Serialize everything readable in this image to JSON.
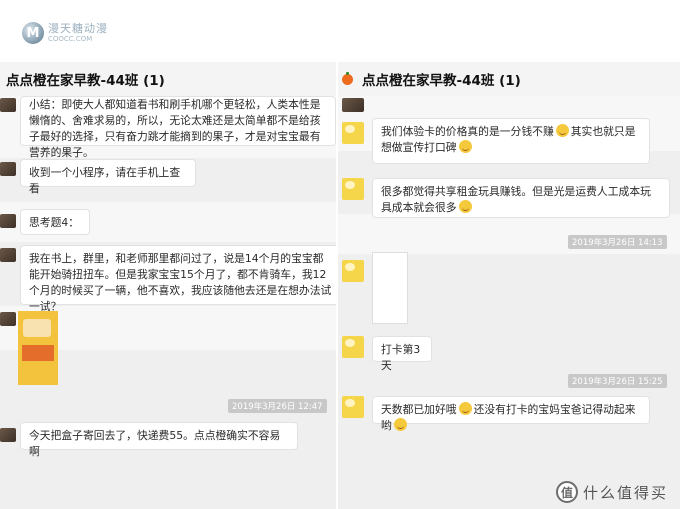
{
  "site_logo": {
    "mark": "M",
    "cn": "漫天糖动漫",
    "en": "COOCC.COM"
  },
  "left_chat": {
    "title": "点点橙在家早教-44班 (1)",
    "messages": [
      "小结：即使大人都知道看书和刷手机哪个更轻松，人类本性是懒惰的、舍难求易的，所以，无论太难还是太简单都不是给孩子最好的选择，只有奋力跳才能摘到的果子，才是对宝宝最有营养的果子。",
      "收到一个小程序，请在手机上查看",
      "思考题4：",
      "我在书上，群里，和老师那里都问过了，说是14个月的宝宝都能开始骑扭扭车。但是我家宝宝15个月了，都不肯骑车，我12个月的时候买了一辆，他不喜欢，我应该随他去还是在想办法试一试？",
      "今天把盒子寄回去了，快递费55。点点橙确实不容易啊"
    ],
    "timestamp": "2019年3月26日 12:47"
  },
  "right_chat": {
    "title": "点点橙在家早教-44班 (1)",
    "messages": [
      "我们体验卡的价格真的是一分钱不赚",
      "其实也就只是想做宣传打口碑",
      "很多都觉得共享租金玩具赚钱。但是光是运费人工成本玩具成本就会很多",
      "打卡第3天",
      "天数都已加好哦",
      "还没有打卡的宝妈宝爸记得动起来哟"
    ],
    "timestamps": [
      "2019年3月26日 14:13",
      "2019年3月26日 15:25"
    ]
  },
  "watermark": {
    "icon": "值",
    "text": "什么值得买"
  },
  "colors": {
    "chat_bg": "#efefef",
    "bubble_bg": "#ffffff",
    "title_dot": "#ef6b1e",
    "timestamp_bg": "#c8c8c8"
  }
}
